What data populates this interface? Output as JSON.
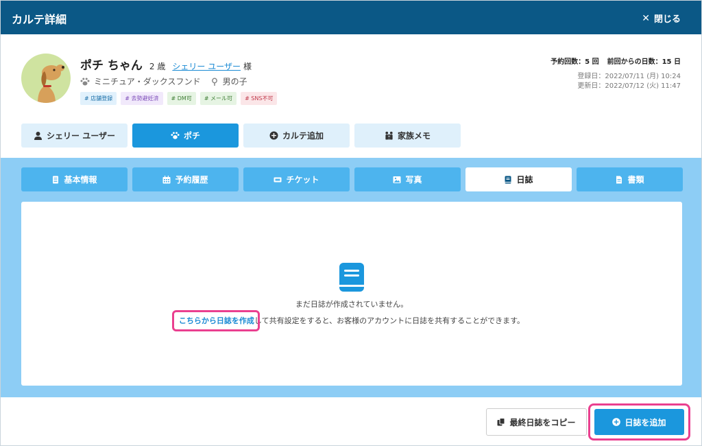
{
  "header": {
    "title": "カルテ詳細",
    "close_label": "閉じる"
  },
  "pet": {
    "name": "ポチ ちゃん",
    "age": "2 歳",
    "owner": "シェリー ユーザー",
    "honorific": "様",
    "breed": "ミニチュア・ダックスフンド",
    "sex": "男の子",
    "tags": [
      {
        "label": "# 店舗登録",
        "bg": "#e1f1fc",
        "color": "#1a6fa8"
      },
      {
        "label": "# 去勢避妊済",
        "bg": "#f1e9fb",
        "color": "#7b4ab8"
      },
      {
        "label": "# DM可",
        "bg": "#e6f4e3",
        "color": "#3e7d34"
      },
      {
        "label": "# メール可",
        "bg": "#e6f4e3",
        "color": "#3e7d34"
      },
      {
        "label": "# SNS不可",
        "bg": "#fbe6e8",
        "color": "#c0394a"
      }
    ]
  },
  "stats": {
    "reservations": "予約回数：5 回",
    "days_since": "前回からの日数：15 日",
    "registered": "登録日：2022/07/11 (月) 10:24",
    "updated": "更新日：2022/07/12 (火) 11:47"
  },
  "person_tabs": [
    {
      "label": "シェリー ユーザー",
      "icon": "user-icon"
    },
    {
      "label": "ポチ",
      "icon": "paw-icon"
    },
    {
      "label": "カルテ追加",
      "icon": "plus-circle-icon"
    },
    {
      "label": "家族メモ",
      "icon": "family-icon"
    }
  ],
  "section_tabs": [
    {
      "label": "基本情報",
      "icon": "document-icon"
    },
    {
      "label": "予約履歴",
      "icon": "calendar-icon"
    },
    {
      "label": "チケット",
      "icon": "ticket-icon"
    },
    {
      "label": "写真",
      "icon": "image-icon"
    },
    {
      "label": "日誌",
      "icon": "book-icon"
    },
    {
      "label": "書類",
      "icon": "file-icon"
    }
  ],
  "empty_state": {
    "message": "まだ日誌が作成されていません。",
    "link_text": "こちらから日誌を作成",
    "rest_text": "して共有設定をすると、お客様のアカウントに日誌を共有することができます。"
  },
  "footer": {
    "copy_label": "最終日誌をコピー",
    "add_label": "日誌を追加"
  },
  "colors": {
    "header": "#0b5886",
    "accent": "#1b97dd",
    "highlight": "#ea3f8f",
    "section_bg": "#8dcdf5"
  }
}
